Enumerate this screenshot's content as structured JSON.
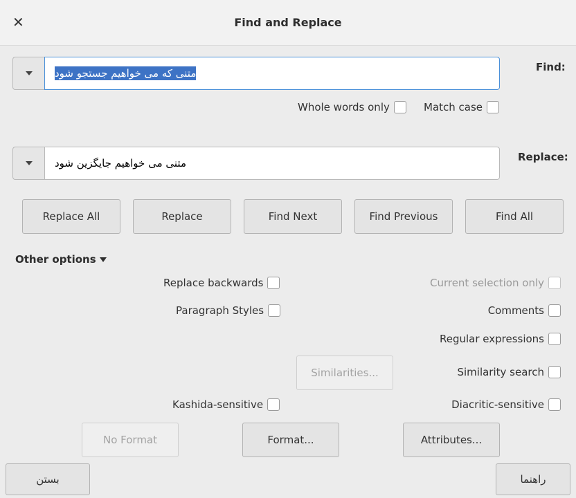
{
  "window": {
    "title": "Find and Replace",
    "close_icon": "close-icon"
  },
  "find": {
    "label": "Find:",
    "value": "متنی که می خواهیم جستجو شود"
  },
  "find_options": {
    "whole_words": "Whole words only",
    "match_case": "Match case"
  },
  "replace": {
    "label": "Replace:",
    "value": "متنی می خواهیم جایگزین شود"
  },
  "actions": {
    "replace_all": "Replace All",
    "replace": "Replace",
    "find_next": "Find Next",
    "find_previous": "Find Previous",
    "find_all": "Find All"
  },
  "other_options": {
    "label": "Other options",
    "replace_backwards": "Replace backwards",
    "paragraph_styles": "Paragraph Styles",
    "current_selection_only": "Current selection only",
    "comments": "Comments",
    "regular_expressions": "Regular expressions",
    "similarities_button": "Similarities...",
    "similarity_search": "Similarity search",
    "kashida_sensitive": "Kashida-sensitive",
    "diacritic_sensitive": "Diacritic-sensitive",
    "no_format": "No Format",
    "format": "Format...",
    "attributes": "Attributes..."
  },
  "footer": {
    "close_label": "بستن",
    "help_label": "راهنما"
  }
}
